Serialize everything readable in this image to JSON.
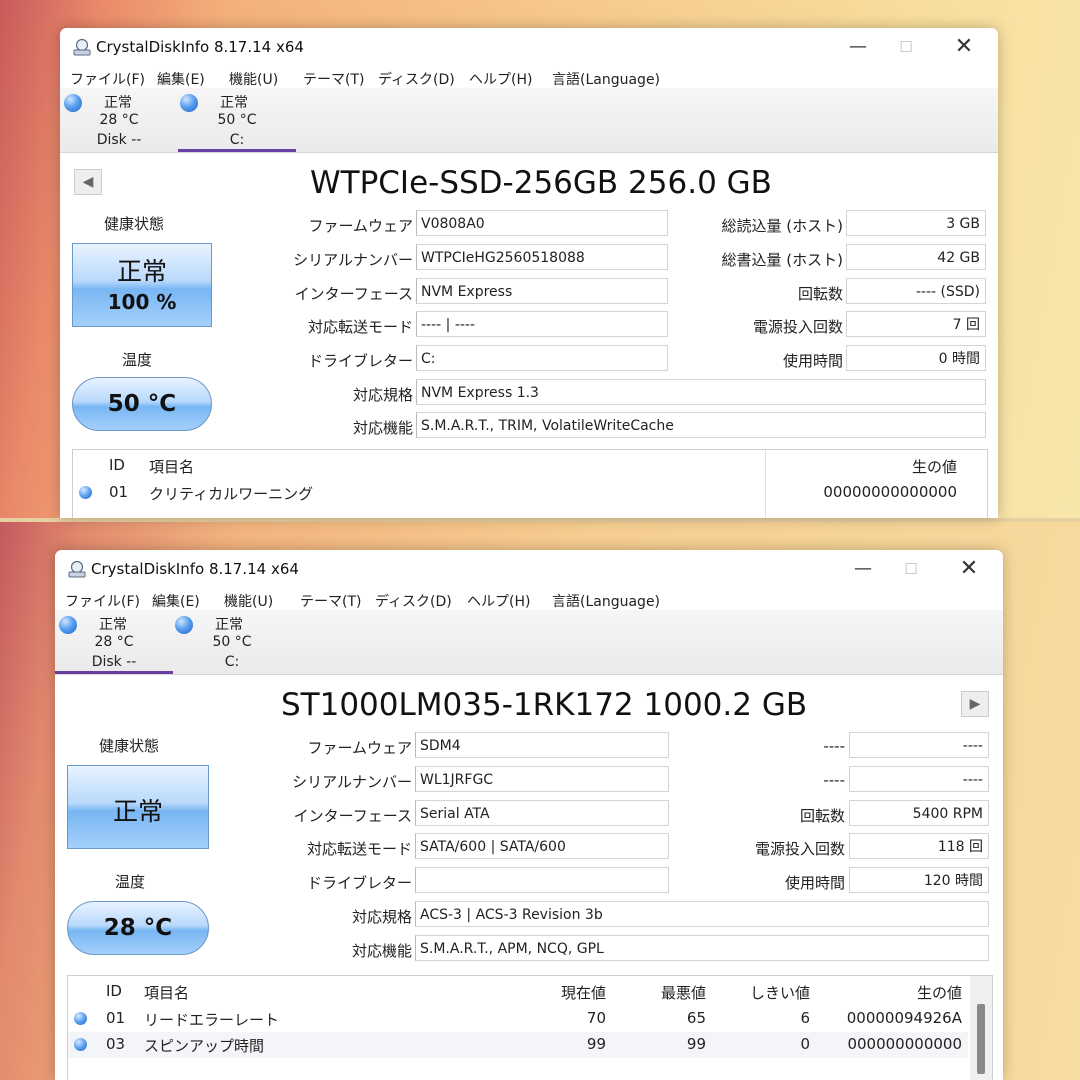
{
  "windows": [
    {
      "title": "CrystalDiskInfo 8.17.14 x64",
      "menu": [
        "ファイル(F)",
        "編集(E)",
        "機能(U)",
        "テーマ(T)",
        "ディスク(D)",
        "ヘルプ(H)",
        "言語(Language)"
      ],
      "disks": [
        {
          "status": "正常",
          "temp": "28 °C",
          "name": "Disk --"
        },
        {
          "status": "正常",
          "temp": "50 °C",
          "name": "C:"
        }
      ],
      "model": "WTPCIe-SSD-256GB 256.0 GB",
      "health_label": "健康状態",
      "health_status": "正常",
      "health_percent": "100 %",
      "temp_label": "温度",
      "temp_value": "50 °C",
      "left_fields": [
        {
          "label": "ファームウェア",
          "value": "V0808A0"
        },
        {
          "label": "シリアルナンバー",
          "value": "WTPCIeHG2560518088"
        },
        {
          "label": "インターフェース",
          "value": "NVM Express"
        },
        {
          "label": "対応転送モード",
          "value": "---- | ----"
        },
        {
          "label": "ドライブレター",
          "value": "C:"
        }
      ],
      "right_fields": [
        {
          "label": "総読込量 (ホスト)",
          "value": "3 GB"
        },
        {
          "label": "総書込量 (ホスト)",
          "value": "42 GB"
        },
        {
          "label": "回転数",
          "value": "---- (SSD)"
        },
        {
          "label": "電源投入回数",
          "value": "7 回"
        },
        {
          "label": "使用時間",
          "value": "0 時間"
        }
      ],
      "standard_label": "対応規格",
      "standard_value": "NVM Express 1.3",
      "features_label": "対応機能",
      "features_value": "S.M.A.R.T., TRIM, VolatileWriteCache",
      "smart_headers": {
        "id": "ID",
        "name": "項目名",
        "raw": "生の値"
      },
      "smart_rows": [
        {
          "id": "01",
          "name": "クリティカルワーニング",
          "raw": "00000000000000"
        }
      ]
    },
    {
      "title": "CrystalDiskInfo 8.17.14 x64",
      "menu": [
        "ファイル(F)",
        "編集(E)",
        "機能(U)",
        "テーマ(T)",
        "ディスク(D)",
        "ヘルプ(H)",
        "言語(Language)"
      ],
      "disks": [
        {
          "status": "正常",
          "temp": "28 °C",
          "name": "Disk --"
        },
        {
          "status": "正常",
          "temp": "50 °C",
          "name": "C:"
        }
      ],
      "model": "ST1000LM035-1RK172 1000.2 GB",
      "health_label": "健康状態",
      "health_status": "正常",
      "temp_label": "温度",
      "temp_value": "28 °C",
      "left_fields": [
        {
          "label": "ファームウェア",
          "value": "SDM4"
        },
        {
          "label": "シリアルナンバー",
          "value": "WL1JRFGC"
        },
        {
          "label": "インターフェース",
          "value": "Serial ATA"
        },
        {
          "label": "対応転送モード",
          "value": "SATA/600 | SATA/600"
        },
        {
          "label": "ドライブレター",
          "value": ""
        }
      ],
      "right_fields": [
        {
          "label": "----",
          "value": "----"
        },
        {
          "label": "----",
          "value": "----"
        },
        {
          "label": "回転数",
          "value": "5400 RPM"
        },
        {
          "label": "電源投入回数",
          "value": "118 回"
        },
        {
          "label": "使用時間",
          "value": "120 時間"
        }
      ],
      "standard_label": "対応規格",
      "standard_value": "ACS-3 | ACS-3 Revision 3b",
      "features_label": "対応機能",
      "features_value": "S.M.A.R.T., APM, NCQ, GPL",
      "smart_headers": {
        "id": "ID",
        "name": "項目名",
        "current": "現在値",
        "worst": "最悪値",
        "threshold": "しきい値",
        "raw": "生の値"
      },
      "smart_rows": [
        {
          "id": "01",
          "name": "リードエラーレート",
          "current": "70",
          "worst": "65",
          "threshold": "6",
          "raw": "00000094926A"
        },
        {
          "id": "03",
          "name": "スピンアップ時間",
          "current": "99",
          "worst": "99",
          "threshold": "0",
          "raw": "000000000000"
        }
      ]
    }
  ]
}
